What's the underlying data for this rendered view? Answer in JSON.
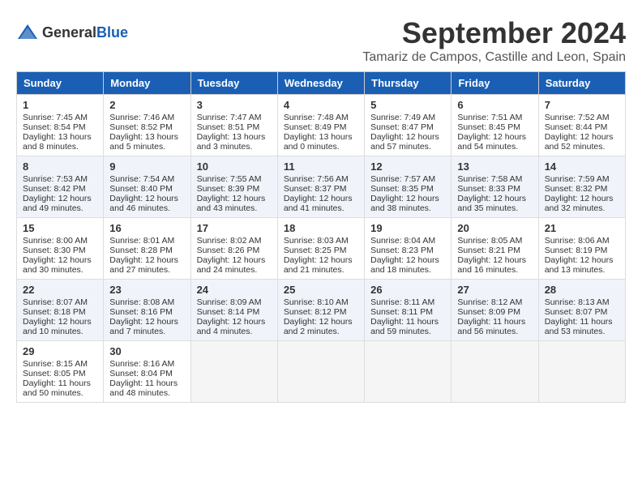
{
  "logo": {
    "general": "General",
    "blue": "Blue"
  },
  "title": "September 2024",
  "subtitle": "Tamariz de Campos, Castille and Leon, Spain",
  "headers": [
    "Sunday",
    "Monday",
    "Tuesday",
    "Wednesday",
    "Thursday",
    "Friday",
    "Saturday"
  ],
  "weeks": [
    [
      {
        "day": "1",
        "lines": [
          "Sunrise: 7:45 AM",
          "Sunset: 8:54 PM",
          "Daylight: 13 hours",
          "and 8 minutes."
        ]
      },
      {
        "day": "2",
        "lines": [
          "Sunrise: 7:46 AM",
          "Sunset: 8:52 PM",
          "Daylight: 13 hours",
          "and 5 minutes."
        ]
      },
      {
        "day": "3",
        "lines": [
          "Sunrise: 7:47 AM",
          "Sunset: 8:51 PM",
          "Daylight: 13 hours",
          "and 3 minutes."
        ]
      },
      {
        "day": "4",
        "lines": [
          "Sunrise: 7:48 AM",
          "Sunset: 8:49 PM",
          "Daylight: 13 hours",
          "and 0 minutes."
        ]
      },
      {
        "day": "5",
        "lines": [
          "Sunrise: 7:49 AM",
          "Sunset: 8:47 PM",
          "Daylight: 12 hours",
          "and 57 minutes."
        ]
      },
      {
        "day": "6",
        "lines": [
          "Sunrise: 7:51 AM",
          "Sunset: 8:45 PM",
          "Daylight: 12 hours",
          "and 54 minutes."
        ]
      },
      {
        "day": "7",
        "lines": [
          "Sunrise: 7:52 AM",
          "Sunset: 8:44 PM",
          "Daylight: 12 hours",
          "and 52 minutes."
        ]
      }
    ],
    [
      {
        "day": "8",
        "lines": [
          "Sunrise: 7:53 AM",
          "Sunset: 8:42 PM",
          "Daylight: 12 hours",
          "and 49 minutes."
        ]
      },
      {
        "day": "9",
        "lines": [
          "Sunrise: 7:54 AM",
          "Sunset: 8:40 PM",
          "Daylight: 12 hours",
          "and 46 minutes."
        ]
      },
      {
        "day": "10",
        "lines": [
          "Sunrise: 7:55 AM",
          "Sunset: 8:39 PM",
          "Daylight: 12 hours",
          "and 43 minutes."
        ]
      },
      {
        "day": "11",
        "lines": [
          "Sunrise: 7:56 AM",
          "Sunset: 8:37 PM",
          "Daylight: 12 hours",
          "and 41 minutes."
        ]
      },
      {
        "day": "12",
        "lines": [
          "Sunrise: 7:57 AM",
          "Sunset: 8:35 PM",
          "Daylight: 12 hours",
          "and 38 minutes."
        ]
      },
      {
        "day": "13",
        "lines": [
          "Sunrise: 7:58 AM",
          "Sunset: 8:33 PM",
          "Daylight: 12 hours",
          "and 35 minutes."
        ]
      },
      {
        "day": "14",
        "lines": [
          "Sunrise: 7:59 AM",
          "Sunset: 8:32 PM",
          "Daylight: 12 hours",
          "and 32 minutes."
        ]
      }
    ],
    [
      {
        "day": "15",
        "lines": [
          "Sunrise: 8:00 AM",
          "Sunset: 8:30 PM",
          "Daylight: 12 hours",
          "and 30 minutes."
        ]
      },
      {
        "day": "16",
        "lines": [
          "Sunrise: 8:01 AM",
          "Sunset: 8:28 PM",
          "Daylight: 12 hours",
          "and 27 minutes."
        ]
      },
      {
        "day": "17",
        "lines": [
          "Sunrise: 8:02 AM",
          "Sunset: 8:26 PM",
          "Daylight: 12 hours",
          "and 24 minutes."
        ]
      },
      {
        "day": "18",
        "lines": [
          "Sunrise: 8:03 AM",
          "Sunset: 8:25 PM",
          "Daylight: 12 hours",
          "and 21 minutes."
        ]
      },
      {
        "day": "19",
        "lines": [
          "Sunrise: 8:04 AM",
          "Sunset: 8:23 PM",
          "Daylight: 12 hours",
          "and 18 minutes."
        ]
      },
      {
        "day": "20",
        "lines": [
          "Sunrise: 8:05 AM",
          "Sunset: 8:21 PM",
          "Daylight: 12 hours",
          "and 16 minutes."
        ]
      },
      {
        "day": "21",
        "lines": [
          "Sunrise: 8:06 AM",
          "Sunset: 8:19 PM",
          "Daylight: 12 hours",
          "and 13 minutes."
        ]
      }
    ],
    [
      {
        "day": "22",
        "lines": [
          "Sunrise: 8:07 AM",
          "Sunset: 8:18 PM",
          "Daylight: 12 hours",
          "and 10 minutes."
        ]
      },
      {
        "day": "23",
        "lines": [
          "Sunrise: 8:08 AM",
          "Sunset: 8:16 PM",
          "Daylight: 12 hours",
          "and 7 minutes."
        ]
      },
      {
        "day": "24",
        "lines": [
          "Sunrise: 8:09 AM",
          "Sunset: 8:14 PM",
          "Daylight: 12 hours",
          "and 4 minutes."
        ]
      },
      {
        "day": "25",
        "lines": [
          "Sunrise: 8:10 AM",
          "Sunset: 8:12 PM",
          "Daylight: 12 hours",
          "and 2 minutes."
        ]
      },
      {
        "day": "26",
        "lines": [
          "Sunrise: 8:11 AM",
          "Sunset: 8:11 PM",
          "Daylight: 11 hours",
          "and 59 minutes."
        ]
      },
      {
        "day": "27",
        "lines": [
          "Sunrise: 8:12 AM",
          "Sunset: 8:09 PM",
          "Daylight: 11 hours",
          "and 56 minutes."
        ]
      },
      {
        "day": "28",
        "lines": [
          "Sunrise: 8:13 AM",
          "Sunset: 8:07 PM",
          "Daylight: 11 hours",
          "and 53 minutes."
        ]
      }
    ],
    [
      {
        "day": "29",
        "lines": [
          "Sunrise: 8:15 AM",
          "Sunset: 8:05 PM",
          "Daylight: 11 hours",
          "and 50 minutes."
        ]
      },
      {
        "day": "30",
        "lines": [
          "Sunrise: 8:16 AM",
          "Sunset: 8:04 PM",
          "Daylight: 11 hours",
          "and 48 minutes."
        ]
      },
      {
        "day": "",
        "lines": []
      },
      {
        "day": "",
        "lines": []
      },
      {
        "day": "",
        "lines": []
      },
      {
        "day": "",
        "lines": []
      },
      {
        "day": "",
        "lines": []
      }
    ]
  ]
}
